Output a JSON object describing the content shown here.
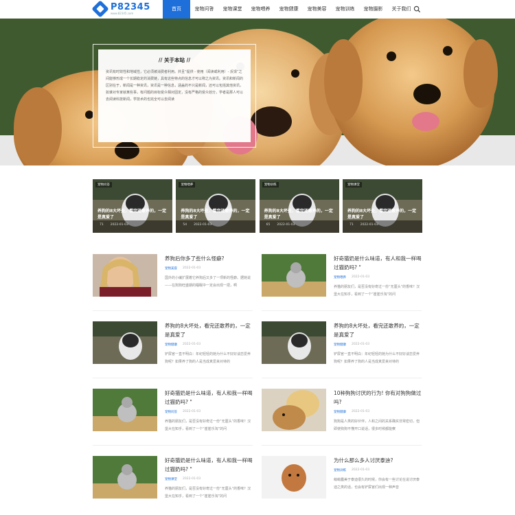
{
  "logo": {
    "name": "P82345",
    "sub": "www.82345.com"
  },
  "nav": {
    "items": [
      "首页",
      "宠物问答",
      "宠物课堂",
      "宠物喂养",
      "宠物健康",
      "宠物美容",
      "宠物训练",
      "宠物摄影",
      "关于我们"
    ],
    "search_icon": "search-icon"
  },
  "about": {
    "title": "// 关于本站 //",
    "body": "资讯有时效性和地域性，它必须被消费者利用。并且“提供 - 使用（阅读或利用）- 反馈”之间能够形成一个长期稳定的消费链，具有这些特点的信息才可以称之为资讯。资讯和新闻的区别在于，新闻是一种资讯，资讯是一种信息，涵盖的不只是新闻，还可以包括其他资讯，如谁对专家就某些事，有问题的目标受众相对固定，没有严格的受众划分，学者是那人可以去阅读科技新闻，学技术的也完全可以去阅读"
  },
  "featured": [
    {
      "tag": "宠物问答",
      "title": "养狗的8大坏处，看完还敢养的，一定是真爱了",
      "count": "71",
      "date": "2022-01-03"
    },
    {
      "tag": "宠物喂养",
      "title": "养狗的8大坏处，看完还敢养的，一定是真爱了",
      "count": "54",
      "date": "2022-01-03"
    },
    {
      "tag": "宠物训练",
      "title": "养狗的8大坏处，看完还敢养的，一定是真爱了",
      "count": "65",
      "date": "2022-01-03"
    },
    {
      "tag": "宠物课堂",
      "title": "养狗的8大坏处，看完还敢养的，一定是真爱了",
      "count": "71",
      "date": "2022-01-03"
    }
  ],
  "articles": [
    {
      "title": "养狗后你多了些什么怪癖?",
      "cat": "宠物美容",
      "date": "2022-01-03",
      "excerpt": "国外的小编扩展着它养狗后又多了一项新的怪癖。据她说——在狗狗旺盛期的睡眠中一定会出现一把，啊",
      "lines": 1,
      "thumb": "woman"
    },
    {
      "title": "好奇猫奶是什么味道，有人和我一样喝过猫奶吗? \"",
      "cat": "宠物喂养",
      "date": "2022-01-03",
      "excerpt": "养猫的朋友们，是否没有好奇过一份“无厘头”的香味？汉堡大在知乎，看到了一个“崔崔乐淘”的问",
      "lines": 2,
      "thumb": "cat"
    },
    {
      "title": "养狗的8大坏处，看完还敢养的，一定是真爱了",
      "cat": "宠物健康",
      "date": "2022-01-03",
      "excerpt": "铲屎官一直不明白：年纪轻轻的她为什么不好好谈恋爱养狗呢？如果养了狗的人是当成真爱来对待的",
      "lines": 2,
      "thumb": "husky"
    },
    {
      "title": "养狗的8大坏处，看完还敢养的，一定是真爱了",
      "cat": "宠物健康",
      "date": "2022-01-03",
      "excerpt": "铲屎官一直不明白：年纪轻轻的她为什么不好好谈恋爱养狗呢？如果养了狗的人是当成真爱来对待的",
      "lines": 2,
      "thumb": "husky"
    },
    {
      "title": "好奇猫奶是什么味道，有人和我一样喝过猫奶吗? \"",
      "cat": "宠物问答",
      "date": "2022-01-03",
      "excerpt": "养猫的朋友们，是否没有好奇过一份“无厘头”的香味？汉堡大在知乎，看到了一个“崔崔乐淘”的问",
      "lines": 2,
      "thumb": "cat"
    },
    {
      "title": "10种狗狗讨厌的行为! 你有对狗狗做过吗?",
      "cat": "宠物健康",
      "date": "2022-01-03",
      "excerpt": "狗狗是人类的好伙伴，人和之间的关系确实非常密切，但即使狗狗不懂开口说话，很多时候都能察",
      "lines": 2,
      "thumb": "girl"
    },
    {
      "title": "好奇猫奶是什么味道，有人和我一样喝过猫奶吗? \"",
      "cat": "宠物课堂",
      "date": "2022-01-03",
      "excerpt": "养猫的朋友们，是否没有好奇过一份“无厘头”的香味？汉堡大在知乎，看到了一个“崔崔乐淘”的问",
      "lines": 2,
      "thumb": "cat"
    },
    {
      "title": "为什么那么多人讨厌泰迪?",
      "cat": "宠物训练",
      "date": "2022-01-03",
      "excerpt": "萌萌蠢美于泰迪很久的时候，你会有一些讨论在说讨厌泰迪之类的话，也会有铲屎官们出现一种声音",
      "lines": 1,
      "thumb": "teddy"
    }
  ]
}
